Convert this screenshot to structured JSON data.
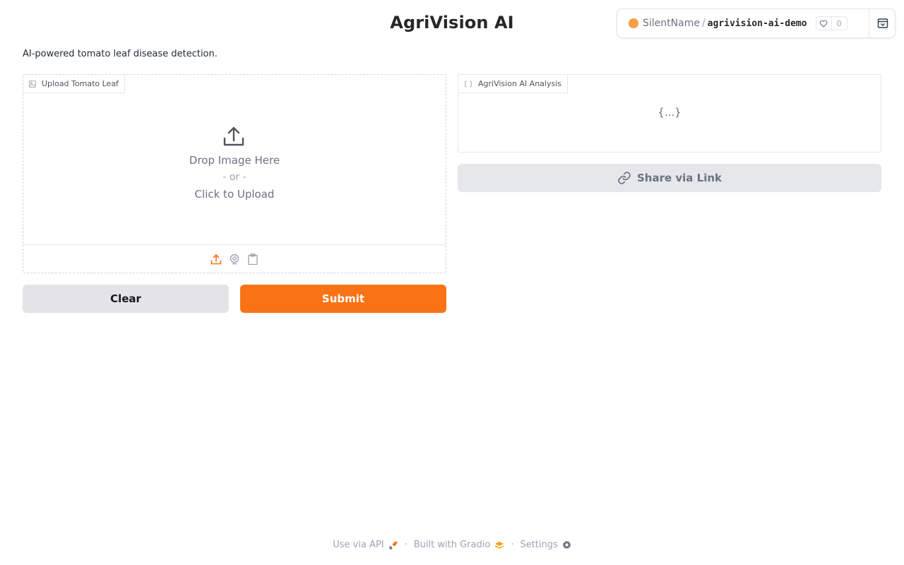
{
  "header": {
    "title": "AgriVision AI",
    "description": "AI-powered tomato leaf disease detection."
  },
  "space": {
    "owner": "SilentName",
    "separator": "/",
    "repo": "agrivision-ai-demo",
    "likes": "0",
    "dot_color": "#f59e42"
  },
  "upload": {
    "label": "Upload Tomato Leaf",
    "drop_text": "Drop Image Here",
    "or_text": "- or -",
    "click_text": "Click to Upload"
  },
  "analysis": {
    "label": "AgriVision AI Analysis",
    "placeholder": "{...}"
  },
  "buttons": {
    "share": "Share via Link",
    "clear": "Clear",
    "submit": "Submit"
  },
  "footer": {
    "api": "Use via API",
    "built": "Built with Gradio",
    "settings": "Settings"
  },
  "colors": {
    "accent": "#f97316",
    "secondary_button": "#e4e4e7"
  }
}
